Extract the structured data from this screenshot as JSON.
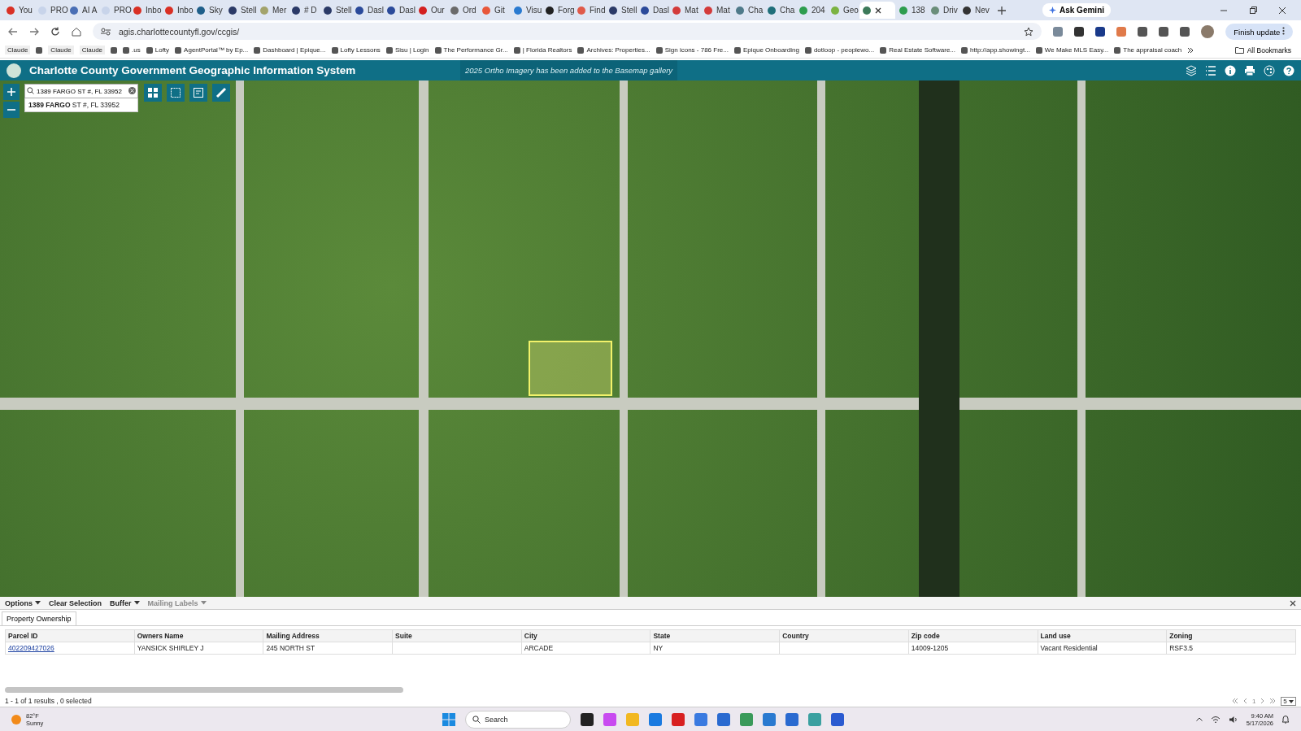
{
  "browser": {
    "tabs": [
      {
        "label": "You",
        "selected": false,
        "color": "#d93025"
      },
      {
        "label": "PRO",
        "selected": false,
        "color": "#c8d4ea"
      },
      {
        "label": "AI A",
        "selected": false,
        "color": "#4a6fb5"
      },
      {
        "label": "PRO",
        "selected": false,
        "color": "#c8d4ea"
      },
      {
        "label": "Inbo",
        "selected": false,
        "color": "#d93025"
      },
      {
        "label": "Inbo",
        "selected": false,
        "color": "#d93025"
      },
      {
        "label": "Sky",
        "selected": false,
        "color": "#1f5f8a"
      },
      {
        "label": "Stell",
        "selected": false,
        "color": "#2b3a67"
      },
      {
        "label": "Mer",
        "selected": false,
        "color": "#a3a36b"
      },
      {
        "label": "# D",
        "selected": false,
        "color": "#2b3a67"
      },
      {
        "label": "Stell",
        "selected": false,
        "color": "#2b3a67"
      },
      {
        "label": "Dasl",
        "selected": false,
        "color": "#2b4a9a"
      },
      {
        "label": "Dasl",
        "selected": false,
        "color": "#2b4a9a"
      },
      {
        "label": "Our",
        "selected": false,
        "color": "#d42020"
      },
      {
        "label": "Ord",
        "selected": false,
        "color": "#6b6b6b"
      },
      {
        "label": "Git",
        "selected": false,
        "color": "#e8573a"
      },
      {
        "label": "Visu",
        "selected": false,
        "color": "#2a7ad0"
      },
      {
        "label": "Forg",
        "selected": false,
        "color": "#222222"
      },
      {
        "label": "Find",
        "selected": false,
        "color": "#e05a4a"
      },
      {
        "label": "Stell",
        "selected": false,
        "color": "#2b3a67"
      },
      {
        "label": "Dasl",
        "selected": false,
        "color": "#2b4a9a"
      },
      {
        "label": "Mat",
        "selected": false,
        "color": "#d33b3b"
      },
      {
        "label": "Mat",
        "selected": false,
        "color": "#d33b3b"
      },
      {
        "label": "Cha",
        "selected": false,
        "color": "#4f7a8a"
      },
      {
        "label": "Cha",
        "selected": false,
        "color": "#1f6f7a"
      },
      {
        "label": "204",
        "selected": false,
        "color": "#2e9d4e"
      },
      {
        "label": "Geo",
        "selected": false,
        "color": "#7cb342"
      },
      {
        "selected": true,
        "color": "#3d7a5a"
      },
      {
        "label": "138",
        "selected": false,
        "color": "#2e9d4e"
      },
      {
        "label": "Driv",
        "selected": false,
        "color": "#6b8e7a"
      },
      {
        "label": "Nev",
        "selected": false,
        "color": "#333333"
      }
    ],
    "ask_gemini": "Ask Gemini",
    "url": "agis.charlottecountyfl.gov/ccgis/",
    "finish_update": "Finish update",
    "bookmarks": [
      {
        "kind": "chip",
        "label": "Claude"
      },
      {
        "kind": "icon"
      },
      {
        "kind": "chip",
        "label": "Claude"
      },
      {
        "kind": "chip",
        "label": "Claude"
      },
      {
        "kind": "icon"
      },
      ".us",
      "Lofty",
      "AgentPortal™ by Ep...",
      "Dashboard | Epique...",
      "Lofty Lessons",
      "Sisu | Login",
      "The Performance Gr...",
      "| Florida Realtors",
      "Archives: Properties...",
      "Sign icons - 786 Fre...",
      "Epique Onboarding",
      "dotloop - peoplewo...",
      "Real Estate Software...",
      "http://app.showingt...",
      "We Make MLS Easy...",
      "The appraisal coach"
    ],
    "all_bookmarks": "All Bookmarks"
  },
  "app": {
    "title": "Charlotte County Government Geographic Information System",
    "notice": "2025 Ortho Imagery has been added to the Basemap gallery",
    "search": {
      "value": "1389 FARGO ST #, FL 33952"
    },
    "suggestion": "**1389 FARGO** ST #, FL 33952"
  },
  "toolbar": [
    {
      "label": "Options",
      "disabled": false
    },
    {
      "label": "Clear Selection",
      "disabled": false
    },
    {
      "label": "Buffer",
      "disabled": false
    },
    {
      "label": "Mailing Labels",
      "disabled": true
    }
  ],
  "panel_tabs": [
    {
      "label": "Property Ownership",
      "selected": true
    }
  ],
  "table": {
    "columns": [
      "Parcel ID",
      "Owners Name",
      "Mailing Address",
      "Suite",
      "City",
      "State",
      "Country",
      "Zip code",
      "Land use",
      "Zoning"
    ],
    "rows": [
      [
        "402209427026",
        "YANSICK SHIRLEY J",
        "245 NORTH ST",
        "",
        "ARCADE",
        "NY",
        "",
        "14009-1205",
        "Vacant Residential",
        "RSF3.5"
      ]
    ]
  },
  "status": "1 - 1 of 1 results , 0 selected",
  "pager": {
    "page": "1",
    "page_size": "5"
  },
  "taskbar": {
    "temperature": "82°F",
    "condition": "Sunny",
    "search": "Search",
    "time": "9:40 AM",
    "date": "5/17/2026"
  }
}
